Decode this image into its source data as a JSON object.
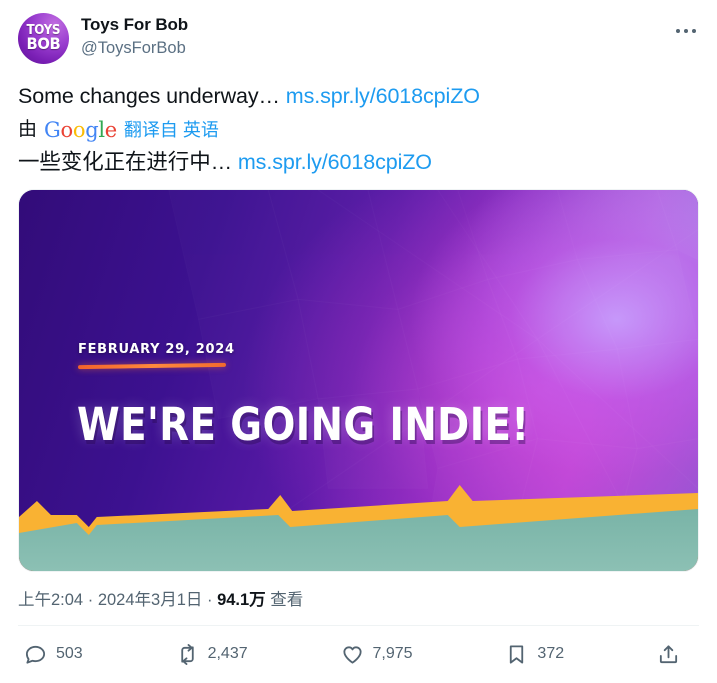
{
  "post": {
    "author": {
      "display_name": "Toys For Bob",
      "handle": "@ToysForBob",
      "avatar_line1": "TOYS",
      "avatar_line2": "BOB"
    },
    "more_options_label": "More",
    "text": {
      "original": "Some changes underway… ",
      "original_link": "ms.spr.ly/6018cpiZO",
      "translation_prefix": "由",
      "google_logo": [
        "G",
        "o",
        "o",
        "g",
        "l",
        "e"
      ],
      "translated_from": "翻译自 英语",
      "translated": "一些变化正在进行中… ",
      "translated_link": "ms.spr.ly/6018cpiZO"
    },
    "media": {
      "alt": "We're Going Indie announcement graphic",
      "date_label": "FEBRUARY 29, 2024",
      "headline": "WE'RE GOING INDIE!",
      "colors": {
        "deep_purple": "#320c79",
        "magenta_glow": "#de50e0",
        "lavender": "#b9c8ff",
        "orange_band": "#f9b233",
        "teal_ground": "#7fb8ab",
        "underline_orange": "#f2622b"
      }
    },
    "meta": {
      "time": "上午2:04",
      "separator": "·",
      "date": "2024年3月1日",
      "views_count": "94.1万",
      "views_label": "查看"
    },
    "actions": [
      {
        "name": "reply",
        "icon": "comment-icon",
        "count": "503"
      },
      {
        "name": "retweet",
        "icon": "retweet-icon",
        "count": "2,437"
      },
      {
        "name": "like",
        "icon": "heart-icon",
        "count": "7,975"
      },
      {
        "name": "bookmark",
        "icon": "bookmark-icon",
        "count": "372"
      },
      {
        "name": "share",
        "icon": "share-icon",
        "count": ""
      }
    ]
  },
  "theme": {
    "link_color": "#1d9bf0",
    "text_color": "#0f1419",
    "muted_color": "#536471",
    "handle_color": "#5b7083",
    "divider_color": "#eff3f4",
    "background": "#ffffff"
  }
}
